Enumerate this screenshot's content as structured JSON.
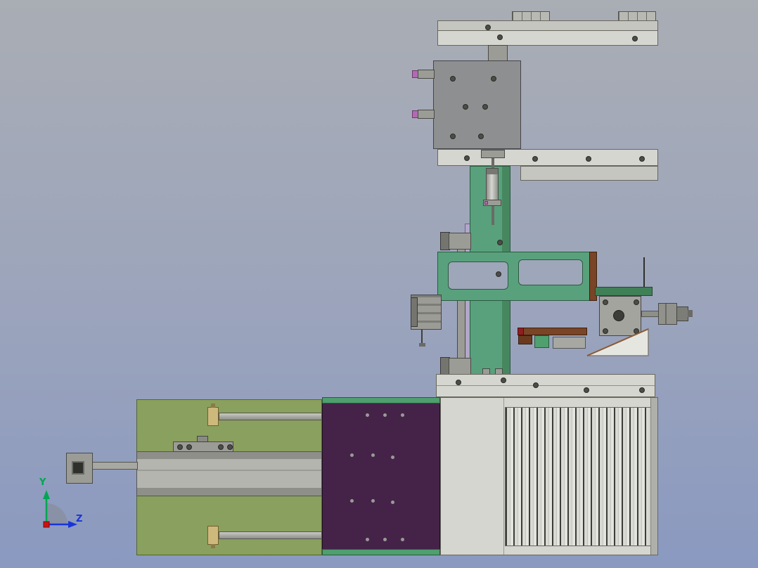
{
  "app": {
    "type": "cad-viewport-screenshot",
    "view": "side-orthographic"
  },
  "triad": {
    "y_label": "Y",
    "z_label": "Z",
    "y_color": "#00a651",
    "z_color": "#1a35d6",
    "x_color": "#cc1111"
  },
  "colors": {
    "background_top": "#a9adb4",
    "background_bottom": "#8a99c0",
    "frame_gray_light": "#d6d6d1",
    "frame_gray_mid": "#9c9c97",
    "gantry_plate_gray": "#8e8f90",
    "machine_green": "#58a17c",
    "base_plate_green": "#8aa05e",
    "mount_plate_purple": "#452349",
    "sensor_magenta": "#b26ab2",
    "rail_brown": "#7a4426",
    "mount_block_tan": "#cdb97c",
    "heatsink_gray": "#d9d9d4"
  },
  "parts": [
    "top-rail-clamps",
    "top-crossbar",
    "gantry-plate",
    "sensor-cylinders",
    "mid-crossbar",
    "vertical-green-column",
    "pneumatic-cylinder",
    "guide-rod-with-caps",
    "green-lift-arm",
    "stepper-motor-assembly",
    "motor-coupling",
    "sheet-metal-bracket",
    "linear-slide-rail",
    "ribbed-clamp-block",
    "bottom-crossbar",
    "base-plate",
    "guide-rods",
    "linear-actuator",
    "purple-mounting-plate",
    "control-box-heatsink",
    "orientation-triad"
  ]
}
